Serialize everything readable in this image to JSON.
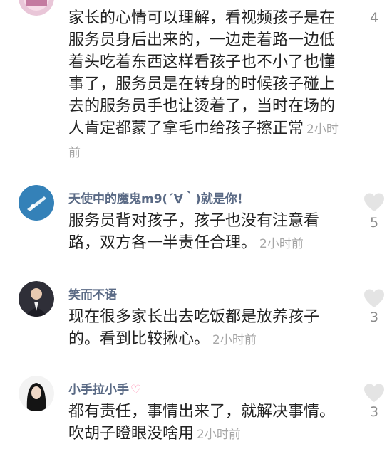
{
  "comments": [
    {
      "username": "",
      "text": "家长的心情可以理解，看视频孩子是在服务员身后出来的，一边走着路一边低着头吃着东西这样看孩子也不小了也懂事了，服务员是在转身的时候孩子碰上去的服务员手也让烫着了，当时在场的人肯定都蒙了拿毛巾给孩子擦正常",
      "time": "2小时前",
      "likes": "4"
    },
    {
      "username": "天使中的魔鬼m9(´∀｀)就是你！",
      "text": "服务员背对孩子，孩子也没有注意看路，双方各一半责任合理。",
      "time": "2小时前",
      "likes": "5"
    },
    {
      "username": "笑而不语",
      "text": "现在很多家长出去吃饭都是放养孩子的。看到比较揪心。",
      "time": "2小时前",
      "likes": "3"
    },
    {
      "username": "小手拉小手",
      "username_emoji": "♡",
      "text": "都有责任，事情出来了，就解决事情。吹胡子瞪眼没啥用",
      "time": "2小时前",
      "likes": "3"
    }
  ],
  "icons": {
    "like": "heart-outline-icon"
  },
  "colors": {
    "username": "#5a6a85",
    "text": "#222222",
    "timestamp": "#a6a6a6",
    "like_icon": "#e4e4e4"
  }
}
